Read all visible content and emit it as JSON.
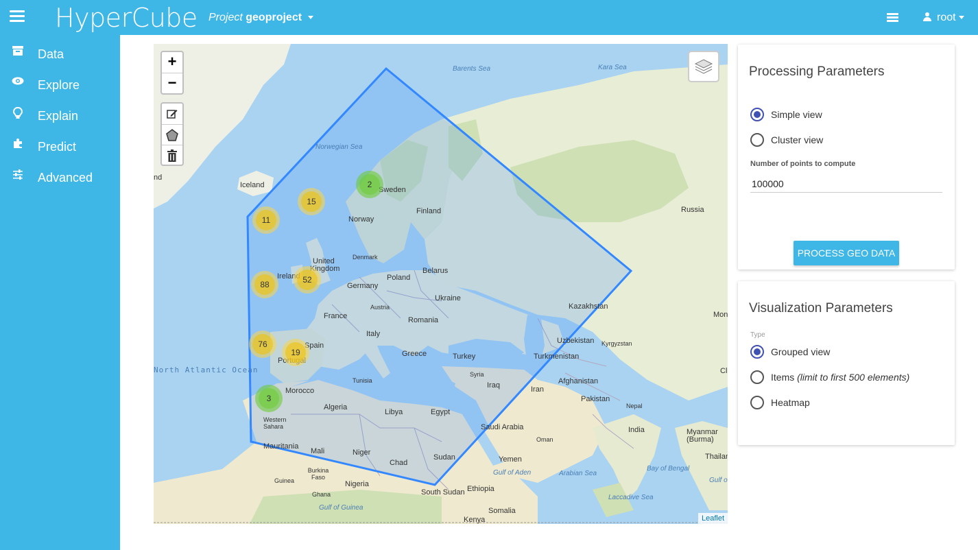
{
  "header": {
    "brand": "HyperCube",
    "project_prefix": "Project",
    "project_name": "geoproject",
    "user": "root",
    "menu_icon": "hamburger-icon",
    "server_icon": "server-icon",
    "user_icon": "user-icon"
  },
  "sidebar": {
    "items": [
      {
        "label": "Data",
        "icon": "archive-icon"
      },
      {
        "label": "Explore",
        "icon": "eye-icon"
      },
      {
        "label": "Explain",
        "icon": "lightbulb-icon"
      },
      {
        "label": "Predict",
        "icon": "puzzle-icon"
      },
      {
        "label": "Advanced",
        "icon": "sliders-icon"
      }
    ]
  },
  "map": {
    "zoom_in": "+",
    "zoom_out": "−",
    "attribution": "Leaflet",
    "labels": {
      "barents_sea": "Barents Sea",
      "kara_sea": "Kara Sea",
      "norwegian_sea": "Norwegian Sea",
      "iceland": "Iceland",
      "sweden": "Sweden",
      "finland": "Finland",
      "norway": "Norway",
      "russia": "Russia",
      "denmark": "Denmark",
      "united": "United",
      "kingdom": "Kingdom",
      "ireland": "Ireland",
      "belarus": "Belarus",
      "poland": "Poland",
      "germany": "Germany",
      "austria": "Austria",
      "ukraine": "Ukraine",
      "france": "France",
      "romania": "Romania",
      "kazakhstan": "Kazakhstan",
      "italy": "Italy",
      "spain": "Spain",
      "portugal": "Portugal",
      "greece": "Greece",
      "turkey": "Turkey",
      "uzbekistan": "Uzbekistan",
      "kyrgyzstan": "Kyrgyzstan",
      "turkmenistan": "Turkmenistan",
      "tunisia": "Tunisia",
      "syria": "Syria",
      "iraq": "Iraq",
      "afghanistan": "Afghanistan",
      "iran": "Iran",
      "pakistan": "Pakistan",
      "morocco": "Morocco",
      "algeria": "Algeria",
      "libya": "Libya",
      "egypt": "Egypt",
      "nepal": "Nepal",
      "western_sahara": "Western Sahara",
      "saudi_arabia": "Saudi Arabia",
      "oman": "Oman",
      "india": "India",
      "myanmar": "Myanmar (Burma)",
      "mauritania": "Mauritania",
      "mali": "Mali",
      "niger": "Niger",
      "chad": "Chad",
      "sudan": "Sudan",
      "yemen": "Yemen",
      "thailand": "Thailan",
      "gulf_of_aden": "Gulf of Aden",
      "arabian_sea": "Arabian Sea",
      "bay_of_bengal": "Bay of Bengal",
      "burkina_faso": "Burkina Faso",
      "guinea": "Guinea",
      "ghana": "Ghana",
      "nigeria": "Nigeria",
      "ethiopia": "Ethiopia",
      "south_sudan": "South Sudan",
      "gulf_of_guinea": "Gulf of Guinea",
      "laccadive_sea": "Laccadive Sea",
      "somalia": "Somalia",
      "kenya": "Kenya",
      "north_atlantic": "North Atlantic Ocean",
      "mon": "Mon",
      "ch": "Cl",
      "nd": "nd",
      "gulf_right": "Gulf o"
    },
    "clusters": [
      {
        "count": "2",
        "color": "green"
      },
      {
        "count": "15",
        "color": "yellow"
      },
      {
        "count": "11",
        "color": "yellow"
      },
      {
        "count": "88",
        "color": "yellow"
      },
      {
        "count": "52",
        "color": "yellow"
      },
      {
        "count": "76",
        "color": "yellow"
      },
      {
        "count": "19",
        "color": "yellow"
      },
      {
        "count": "3",
        "color": "green"
      }
    ]
  },
  "processing": {
    "title": "Processing Parameters",
    "options": [
      "Simple view",
      "Cluster view"
    ],
    "selected": "Simple view",
    "points_label": "Number of points to compute",
    "points_value": "100000",
    "button": "PROCESS GEO DATA"
  },
  "visualization": {
    "title": "Visualization Parameters",
    "type_label": "Type",
    "options": [
      "Grouped view",
      "Items",
      "Heatmap"
    ],
    "items_note": "(limit to first 500 elements)",
    "selected": "Grouped view"
  },
  "colors": {
    "accent": "#3fb7e6",
    "radio": "#3f51b5",
    "polygon": "#3388ff",
    "cluster_yellow": "#f0c20c",
    "cluster_green": "#6ecc39"
  }
}
